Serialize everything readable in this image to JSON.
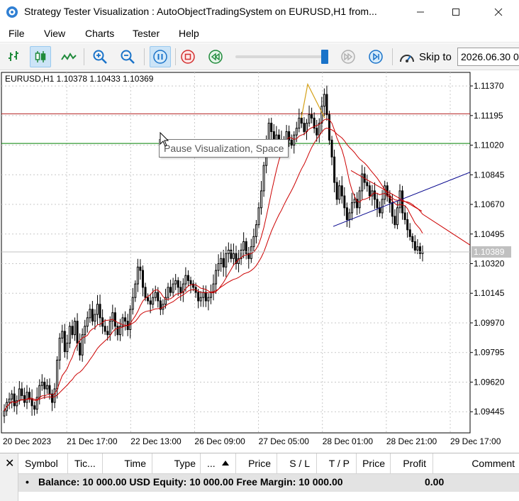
{
  "window": {
    "title": "Strategy Tester Visualization : AutoObjectTradingSystem on EURUSD,H1 from..."
  },
  "menu": [
    "File",
    "View",
    "Charts",
    "Tester",
    "Help"
  ],
  "toolbar": {
    "skip_label": "Skip to",
    "skip_value": "2026.06.30 0",
    "speed_percent": 95,
    "tooltip": "Pause Visualization, Space"
  },
  "chart": {
    "header": "EURUSD,H1  1.10378 1.10433 1.10369",
    "current_price_label": "1.10389",
    "colors": {
      "candles": "#000000",
      "ma": "#cc0000",
      "hline_red": "#b22222",
      "hline_green": "#008000",
      "trend_blue": "#00008b",
      "zigzag": "#d4a017",
      "grid": "#c8c8c8"
    }
  },
  "chart_data": {
    "type": "candlestick",
    "symbol": "EURUSD",
    "timeframe": "H1",
    "y_ticks": [
      1.1137,
      1.11195,
      1.1102,
      1.10845,
      1.1067,
      1.10495,
      1.1032,
      1.10145,
      1.0997,
      1.09795,
      1.0962,
      1.09445
    ],
    "ylim": [
      1.0932,
      1.1145
    ],
    "x_ticks": [
      "20 Dec 2023",
      "21 Dec 17:00",
      "22 Dec 13:00",
      "26 Dec 09:00",
      "27 Dec 05:00",
      "28 Dec 01:00",
      "28 Dec 21:00",
      "29 Dec 17:00"
    ],
    "hlines": [
      {
        "price": 1.11205,
        "color": "red"
      },
      {
        "price": 1.1103,
        "color": "green"
      }
    ],
    "last_price": 1.10389,
    "ohlc_closes": [
      1.0945,
      1.095,
      1.0952,
      1.0955,
      1.0948,
      1.0951,
      1.0958,
      1.0954,
      1.095,
      1.0956,
      1.0952,
      1.0948,
      1.0946,
      1.0953,
      1.096,
      1.0962,
      1.0958,
      1.096,
      1.0955,
      1.095,
      1.0958,
      1.0975,
      1.0988,
      1.0992,
      1.098,
      1.0985,
      1.0995,
      1.099,
      1.0998,
      1.0985,
      1.0978,
      1.099,
      1.0995,
      1.1,
      1.1005,
      1.0998,
      1.1002,
      1.1008,
      1.1,
      1.0995,
      1.0992,
      1.099,
      1.0998,
      1.1003,
      1.0995,
      1.099,
      1.0995,
      1.1,
      1.0998,
      1.0993,
      1.1005,
      1.1012,
      1.102,
      1.103,
      1.1028,
      1.1018,
      1.1012,
      1.101,
      1.1008,
      1.1012,
      1.1015,
      1.101,
      1.1005,
      1.1008,
      1.1012,
      1.1018,
      1.1015,
      1.102,
      1.1022,
      1.1018,
      1.1015,
      1.102,
      1.1025,
      1.1022,
      1.102,
      1.1018,
      1.1015,
      1.101,
      1.1012,
      1.1015,
      1.101,
      1.1012,
      1.1015,
      1.102,
      1.1028,
      1.1032,
      1.1035,
      1.103,
      1.1038,
      1.104,
      1.1035,
      1.1038,
      1.1032,
      1.1035,
      1.104,
      1.1045,
      1.1038,
      1.1035,
      1.1042,
      1.1048,
      1.1055,
      1.1065,
      1.1075,
      1.109,
      1.1105,
      1.1115,
      1.111,
      1.1102,
      1.1108,
      1.1105,
      1.11,
      1.1105,
      1.111,
      1.1105,
      1.1102,
      1.1108,
      1.1112,
      1.1118,
      1.1115,
      1.111,
      1.1115,
      1.112,
      1.1118,
      1.1112,
      1.1108,
      1.1115,
      1.1125,
      1.1132,
      1.112,
      1.1105,
      1.1095,
      1.108,
      1.107,
      1.1078,
      1.1072,
      1.1065,
      1.1058,
      1.1062,
      1.1068,
      1.107,
      1.1065,
      1.1075,
      1.1085,
      1.108,
      1.1078,
      1.1072,
      1.1075,
      1.107,
      1.1065,
      1.1062,
      1.107,
      1.1078,
      1.1072,
      1.1068,
      1.106,
      1.1055,
      1.1065,
      1.1075,
      1.1062,
      1.1058,
      1.1052,
      1.1048,
      1.1045,
      1.104,
      1.1042,
      1.1038,
      1.1039
    ]
  },
  "bottom_panel": {
    "columns": [
      "Symbol",
      "Tic...",
      "Time",
      "Type",
      "...",
      "Price",
      "S / L",
      "T / P",
      "Price",
      "Profit",
      "Comment"
    ],
    "balance_text": "Balance: 10 000.00 USD  Equity: 10 000.00  Free Margin: 10 000.00",
    "profit": "0.00"
  }
}
